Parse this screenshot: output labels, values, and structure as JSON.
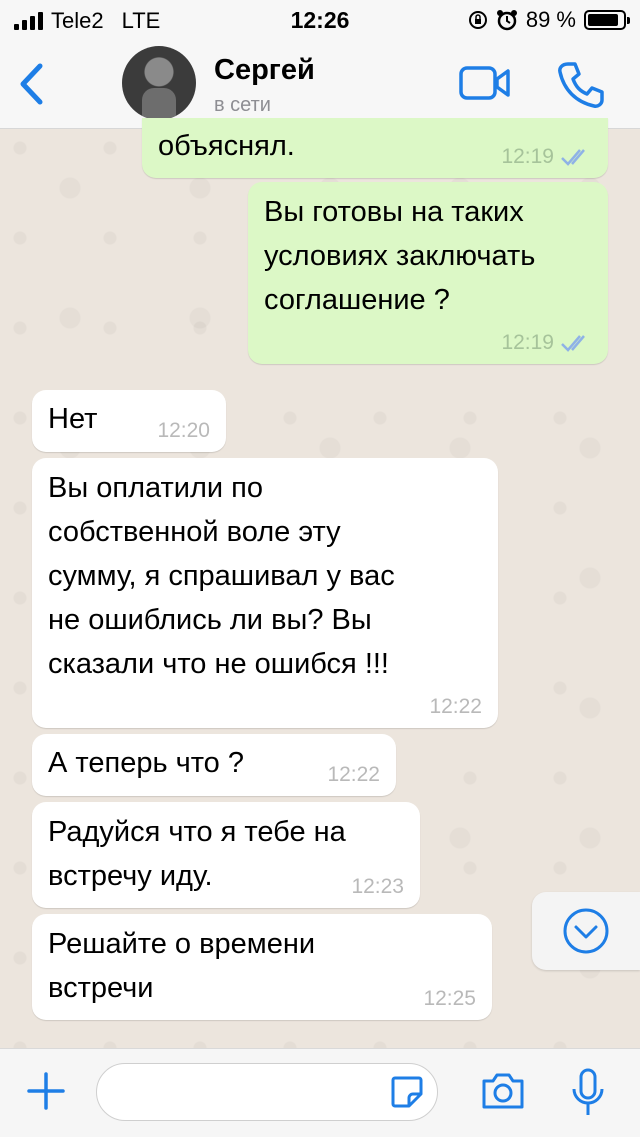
{
  "status_bar": {
    "carrier": "Tele2",
    "network": "LTE",
    "time": "12:26",
    "battery_percent": "89 %",
    "battery_level": 0.89
  },
  "header": {
    "back_icon": "chevron-left-icon",
    "contact_name": "Сергей",
    "contact_status": "в сети",
    "video_icon": "video-camera-icon",
    "call_icon": "phone-icon",
    "accent_color": "#1e7ee6"
  },
  "messages": [
    {
      "direction": "out",
      "text": "объяснял.",
      "time": "12:19",
      "status": "read"
    },
    {
      "direction": "out",
      "text": "Вы готовы на таких\nусловиях заключать\nсоглашение ?",
      "time": "12:19",
      "status": "read"
    },
    {
      "direction": "in",
      "text": "Нет",
      "time": "12:20"
    },
    {
      "direction": "in",
      "text": "Вы оплатили по\nсобственной воле эту\nсумму, я спрашивал у вас\nне ошиблись ли вы? Вы\nсказали что не ошибся !!!",
      "time": "12:22"
    },
    {
      "direction": "in",
      "text": "А теперь что ?",
      "time": "12:22"
    },
    {
      "direction": "in",
      "text": "Радуйся что я тебе на\nвстречу  иду.",
      "time": "12:23"
    },
    {
      "direction": "in",
      "text": "Решайте о времени\nвстречи",
      "time": "12:25"
    }
  ],
  "input_bar": {
    "attach_icon": "plus-icon",
    "message_value": "",
    "sticker_icon": "sticker-icon",
    "camera_icon": "camera-icon",
    "mic_icon": "microphone-icon"
  },
  "scroll_down_icon": "chevron-down-circle-icon"
}
